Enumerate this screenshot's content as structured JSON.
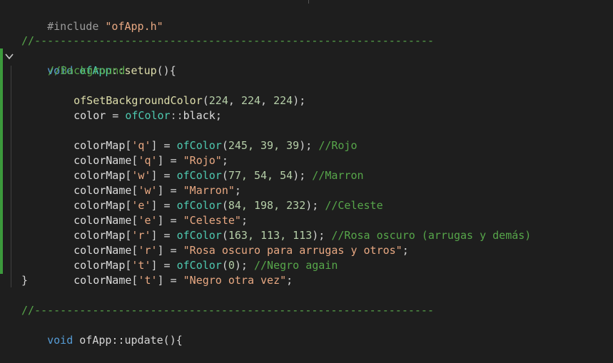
{
  "editor": {
    "top_tab_fragment": "[ ] . . .",
    "include": {
      "directive": "#include",
      "file": "\"ofApp.h\""
    },
    "separator_comment": "//--------------------------------------------------------------",
    "setup_signature": {
      "kw": "void",
      "cls": "ofApp",
      "sep": "::",
      "fn": "setup",
      "rest": "(){"
    },
    "bg_comment": "//Background",
    "bg_call": {
      "fn": "ofSetBackgroundColor",
      "open": "(",
      "a": "224",
      "b": "224",
      "c": "224",
      "close": ");"
    },
    "color_line": {
      "var": "color",
      "eq": " = ",
      "type": "ofColor",
      "sep": "::",
      "val": "black",
      "end": ";"
    },
    "map_lines": [
      {
        "var": "colorMap",
        "key": "'q'",
        "args": "245, 39, 39",
        "comment": "//Rojo"
      },
      {
        "var": "colorMap",
        "key": "'w'",
        "args": "77, 54, 54",
        "comment": "//Marron"
      },
      {
        "var": "colorMap",
        "key": "'e'",
        "args": "84, 198, 232",
        "comment": "//Celeste"
      },
      {
        "var": "colorMap",
        "key": "'r'",
        "args": "163, 113, 113",
        "comment": "//Rosa oscuro (arrugas y demás)"
      },
      {
        "var": "colorMap",
        "key": "'t'",
        "args": "0",
        "comment": "//Negro again"
      }
    ],
    "name_lines": [
      {
        "var": "colorName",
        "key": "'q'",
        "str": "\"Rojo\""
      },
      {
        "var": "colorName",
        "key": "'w'",
        "str": "\"Marron\""
      },
      {
        "var": "colorName",
        "key": "'e'",
        "str": "\"Celeste\""
      },
      {
        "var": "colorName",
        "key": "'r'",
        "str": "\"Rosa oscuro para arrugas y otros\""
      },
      {
        "var": "colorName",
        "key": "'t'",
        "str": "\"Negro otra vez\""
      }
    ],
    "close_brace": "}",
    "bottom_partial": "void ofApp::update(){"
  },
  "colors": {
    "background": "#1e1e1e",
    "keyword": "#569cd6",
    "type": "#4ec9b0",
    "function": "#dcdcaa",
    "string": "#e8a882",
    "comment": "#57a64a",
    "number": "#b5cea8",
    "change_bar": "#3c9a3c"
  }
}
